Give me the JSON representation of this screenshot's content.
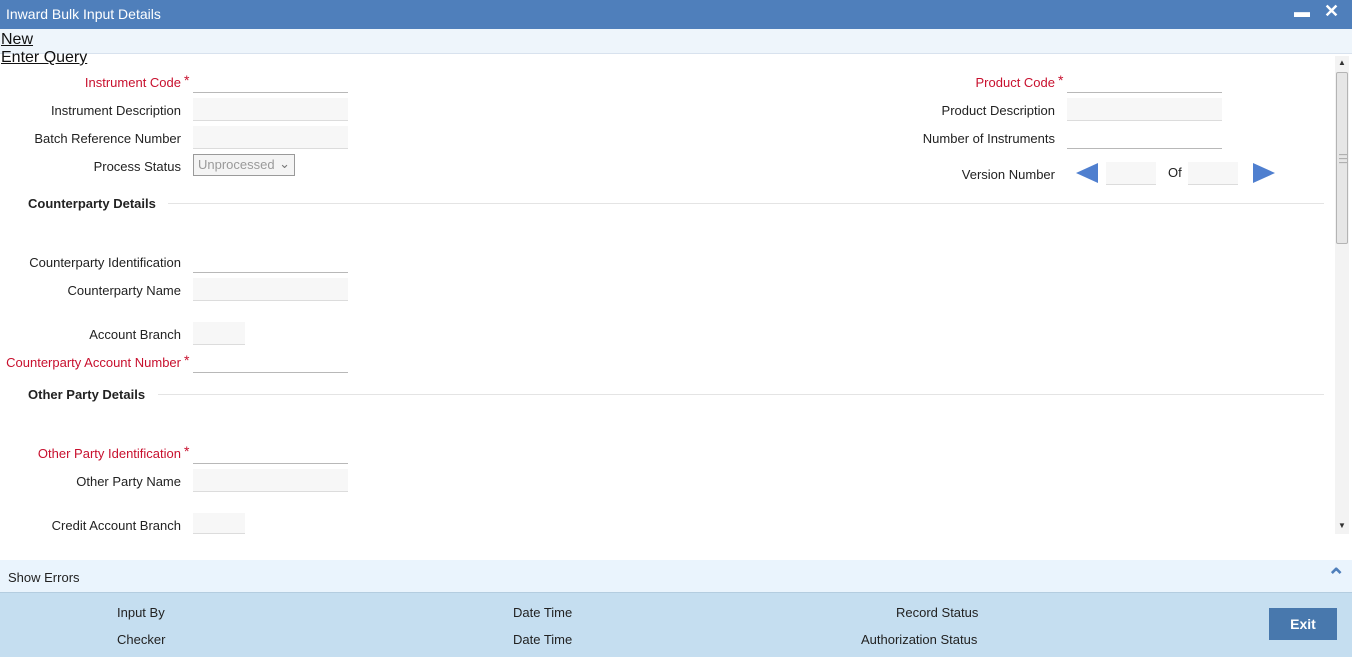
{
  "window": {
    "title": "Inward Bulk Input Details",
    "minimize": "▬",
    "close": "✕"
  },
  "menu": {
    "new": "New",
    "enter_query": "Enter Query"
  },
  "fields": {
    "instrument_code": {
      "label": "Instrument Code",
      "value": ""
    },
    "instrument_description": {
      "label": "Instrument Description",
      "value": ""
    },
    "batch_reference_number": {
      "label": "Batch Reference Number",
      "value": ""
    },
    "process_status": {
      "label": "Process Status",
      "value": "Unprocessed"
    },
    "product_code": {
      "label": "Product Code",
      "value": ""
    },
    "product_description": {
      "label": "Product Description",
      "value": ""
    },
    "number_of_instruments": {
      "label": "Number of Instruments",
      "value": ""
    },
    "version_number": {
      "label": "Version Number",
      "value": "",
      "of_label": "Of",
      "of_value": ""
    }
  },
  "counterparty": {
    "heading": "Counterparty Details",
    "identification": {
      "label": "Counterparty Identification",
      "value": ""
    },
    "name": {
      "label": "Counterparty Name",
      "value": ""
    },
    "account_branch": {
      "label": "Account Branch",
      "value": ""
    },
    "account_number": {
      "label": "Counterparty Account Number",
      "value": ""
    }
  },
  "other_party": {
    "heading": "Other Party Details",
    "identification": {
      "label": "Other Party Identification",
      "value": ""
    },
    "name": {
      "label": "Other Party Name",
      "value": ""
    },
    "credit_account_branch": {
      "label": "Credit Account Branch",
      "value": ""
    }
  },
  "required_marker": "*",
  "errors_bar": {
    "label": "Show Errors"
  },
  "footer": {
    "input_by": "Input By",
    "date_time_1": "Date Time",
    "record_status": "Record Status",
    "checker": "Checker",
    "date_time_2": "Date Time",
    "authorization_status": "Authorization Status",
    "exit_label": "Exit"
  },
  "colors": {
    "titlebar": "#4f7fbb",
    "required": "#c8102e",
    "footer": "#c5def0",
    "exit_button": "#4878ad",
    "nav_arrow": "#4f7fcf"
  }
}
